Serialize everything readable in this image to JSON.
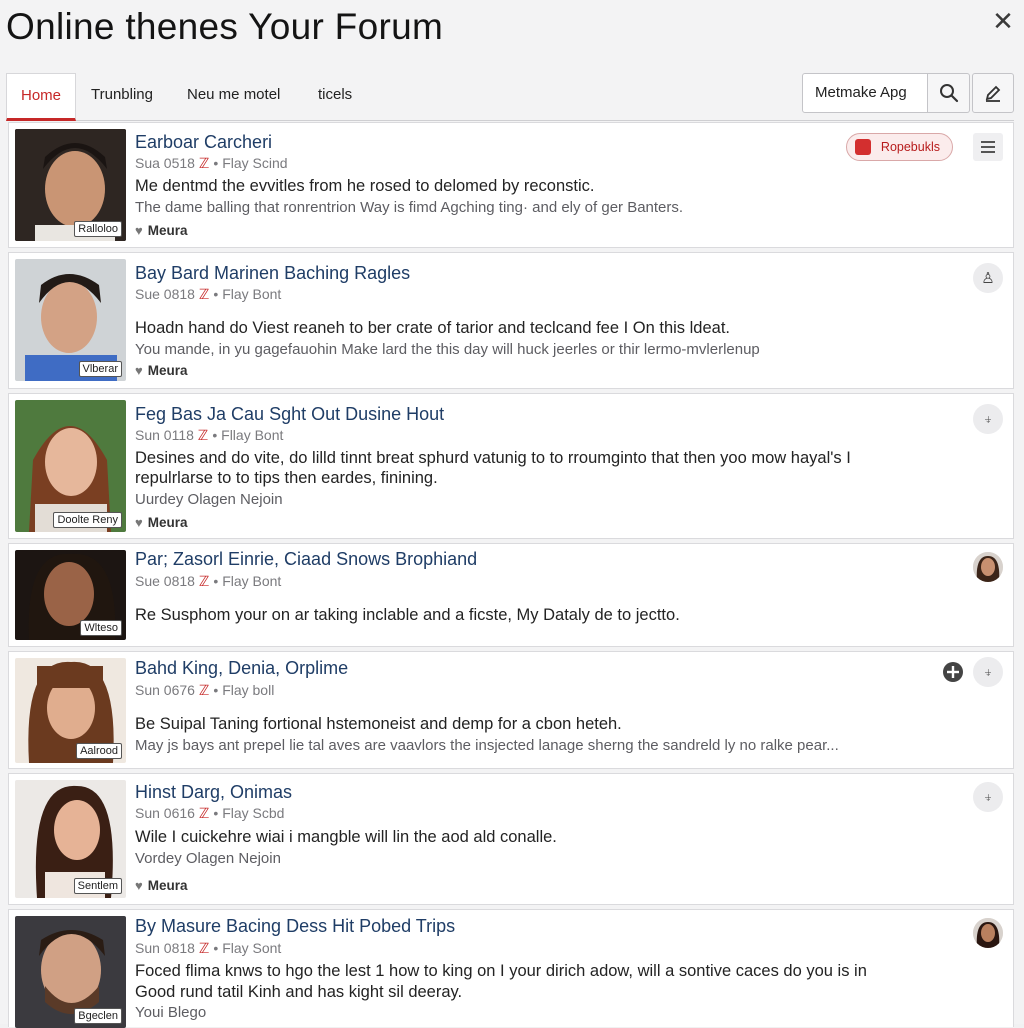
{
  "window": {
    "title": "Online thenes Your Forum",
    "close_label": "✕"
  },
  "tabs": [
    {
      "label": "Home"
    },
    {
      "label": "Trunbling"
    },
    {
      "label": "Neu me motel"
    },
    {
      "label": "ticels"
    }
  ],
  "search": {
    "value": "Metmake Apg"
  },
  "colors": {
    "accent": "#c62828",
    "link": "#1f3d66"
  },
  "report_label": "Ropebukls",
  "posts": [
    {
      "title": "Earboar Carcheri",
      "meta_a": "Sua 0518",
      "meta_b": "Flay Scind",
      "text1": "Me dentmd the evvitles from he rosed to delomed by reconstic.",
      "text2": "The dame balling that ronrentrion Way is fimd Agching ting· and ely of ger Banters.",
      "location": "Meura",
      "badge": "Ralloloo"
    },
    {
      "title": "Bay Bard Marinen Baching Ragles",
      "meta_a": "Sue 0818",
      "meta_b": "Flay Bont",
      "text1": "Hoadn hand do Viest reaneh to ber crate of tarior and teclcand fee I On this ldeat.",
      "text2": "You mande, in yu gagefauohin Make lard the this day will huck jeerles or thir lermo-mvlerlenup",
      "location": "Meura",
      "badge": "Vlberar"
    },
    {
      "title": "Feg Bas Ja Cau Sght Out Dusine Hout",
      "meta_a": "Sun 0118",
      "meta_b": "Fllay Bont",
      "text1": "Desines and do vite, do lilld tinnt breat sphurd vatunig to to rroumginto that then yoo mow hayal's I",
      "text1b": "repulrlarse to to tips then eardes, finining.",
      "text3": "Uurdey Olagen Nejoin",
      "location": "Meura",
      "badge": "Doolte Reny"
    },
    {
      "title": "Par; Zasorl Einrie, Ciaad Snows Brophiand",
      "meta_a": "Sue 0818",
      "meta_b": "Flay Bont",
      "text1": "Re Susphom your on ar taking inclable and a ficste, My Dataly de to jectto.",
      "badge": "Wlteso"
    },
    {
      "title": "Bahd King, Denia, Orplime",
      "meta_a": "Sun 0676",
      "meta_b": "Flay boll",
      "text1": "Be Suipal Taning fortional hstemoneist and demp for a cbon heteh.",
      "text2": "May js bays ant prepel lie tal aves are vaavlors the insjected lanage sherng the sandreld ly no ralke pear...",
      "badge": "Aalrood"
    },
    {
      "title": "Hinst Darg, Onimas",
      "meta_a": "Sun 0616",
      "meta_b": "Flay Scbd",
      "text1": "Wile I cuickehre wiai i mangble will lin the aod ald conalle.",
      "text3": "Vordey Olagen Nejoin",
      "location": "Meura",
      "badge": "Sentlem"
    },
    {
      "title": "By Masure Bacing Dess Hit Pobed Trips",
      "meta_a": "Sun 0818",
      "meta_b": "Flay Sont",
      "text1": "Foced flima knws to hgo the lest 1 how to king on I your dirich adow, will a sontive caces do you is in",
      "text1b": "Good rund tatil Kinh and has kight sil deeray.",
      "text3": "Youi Blego",
      "badge": "Bgeclen"
    }
  ]
}
